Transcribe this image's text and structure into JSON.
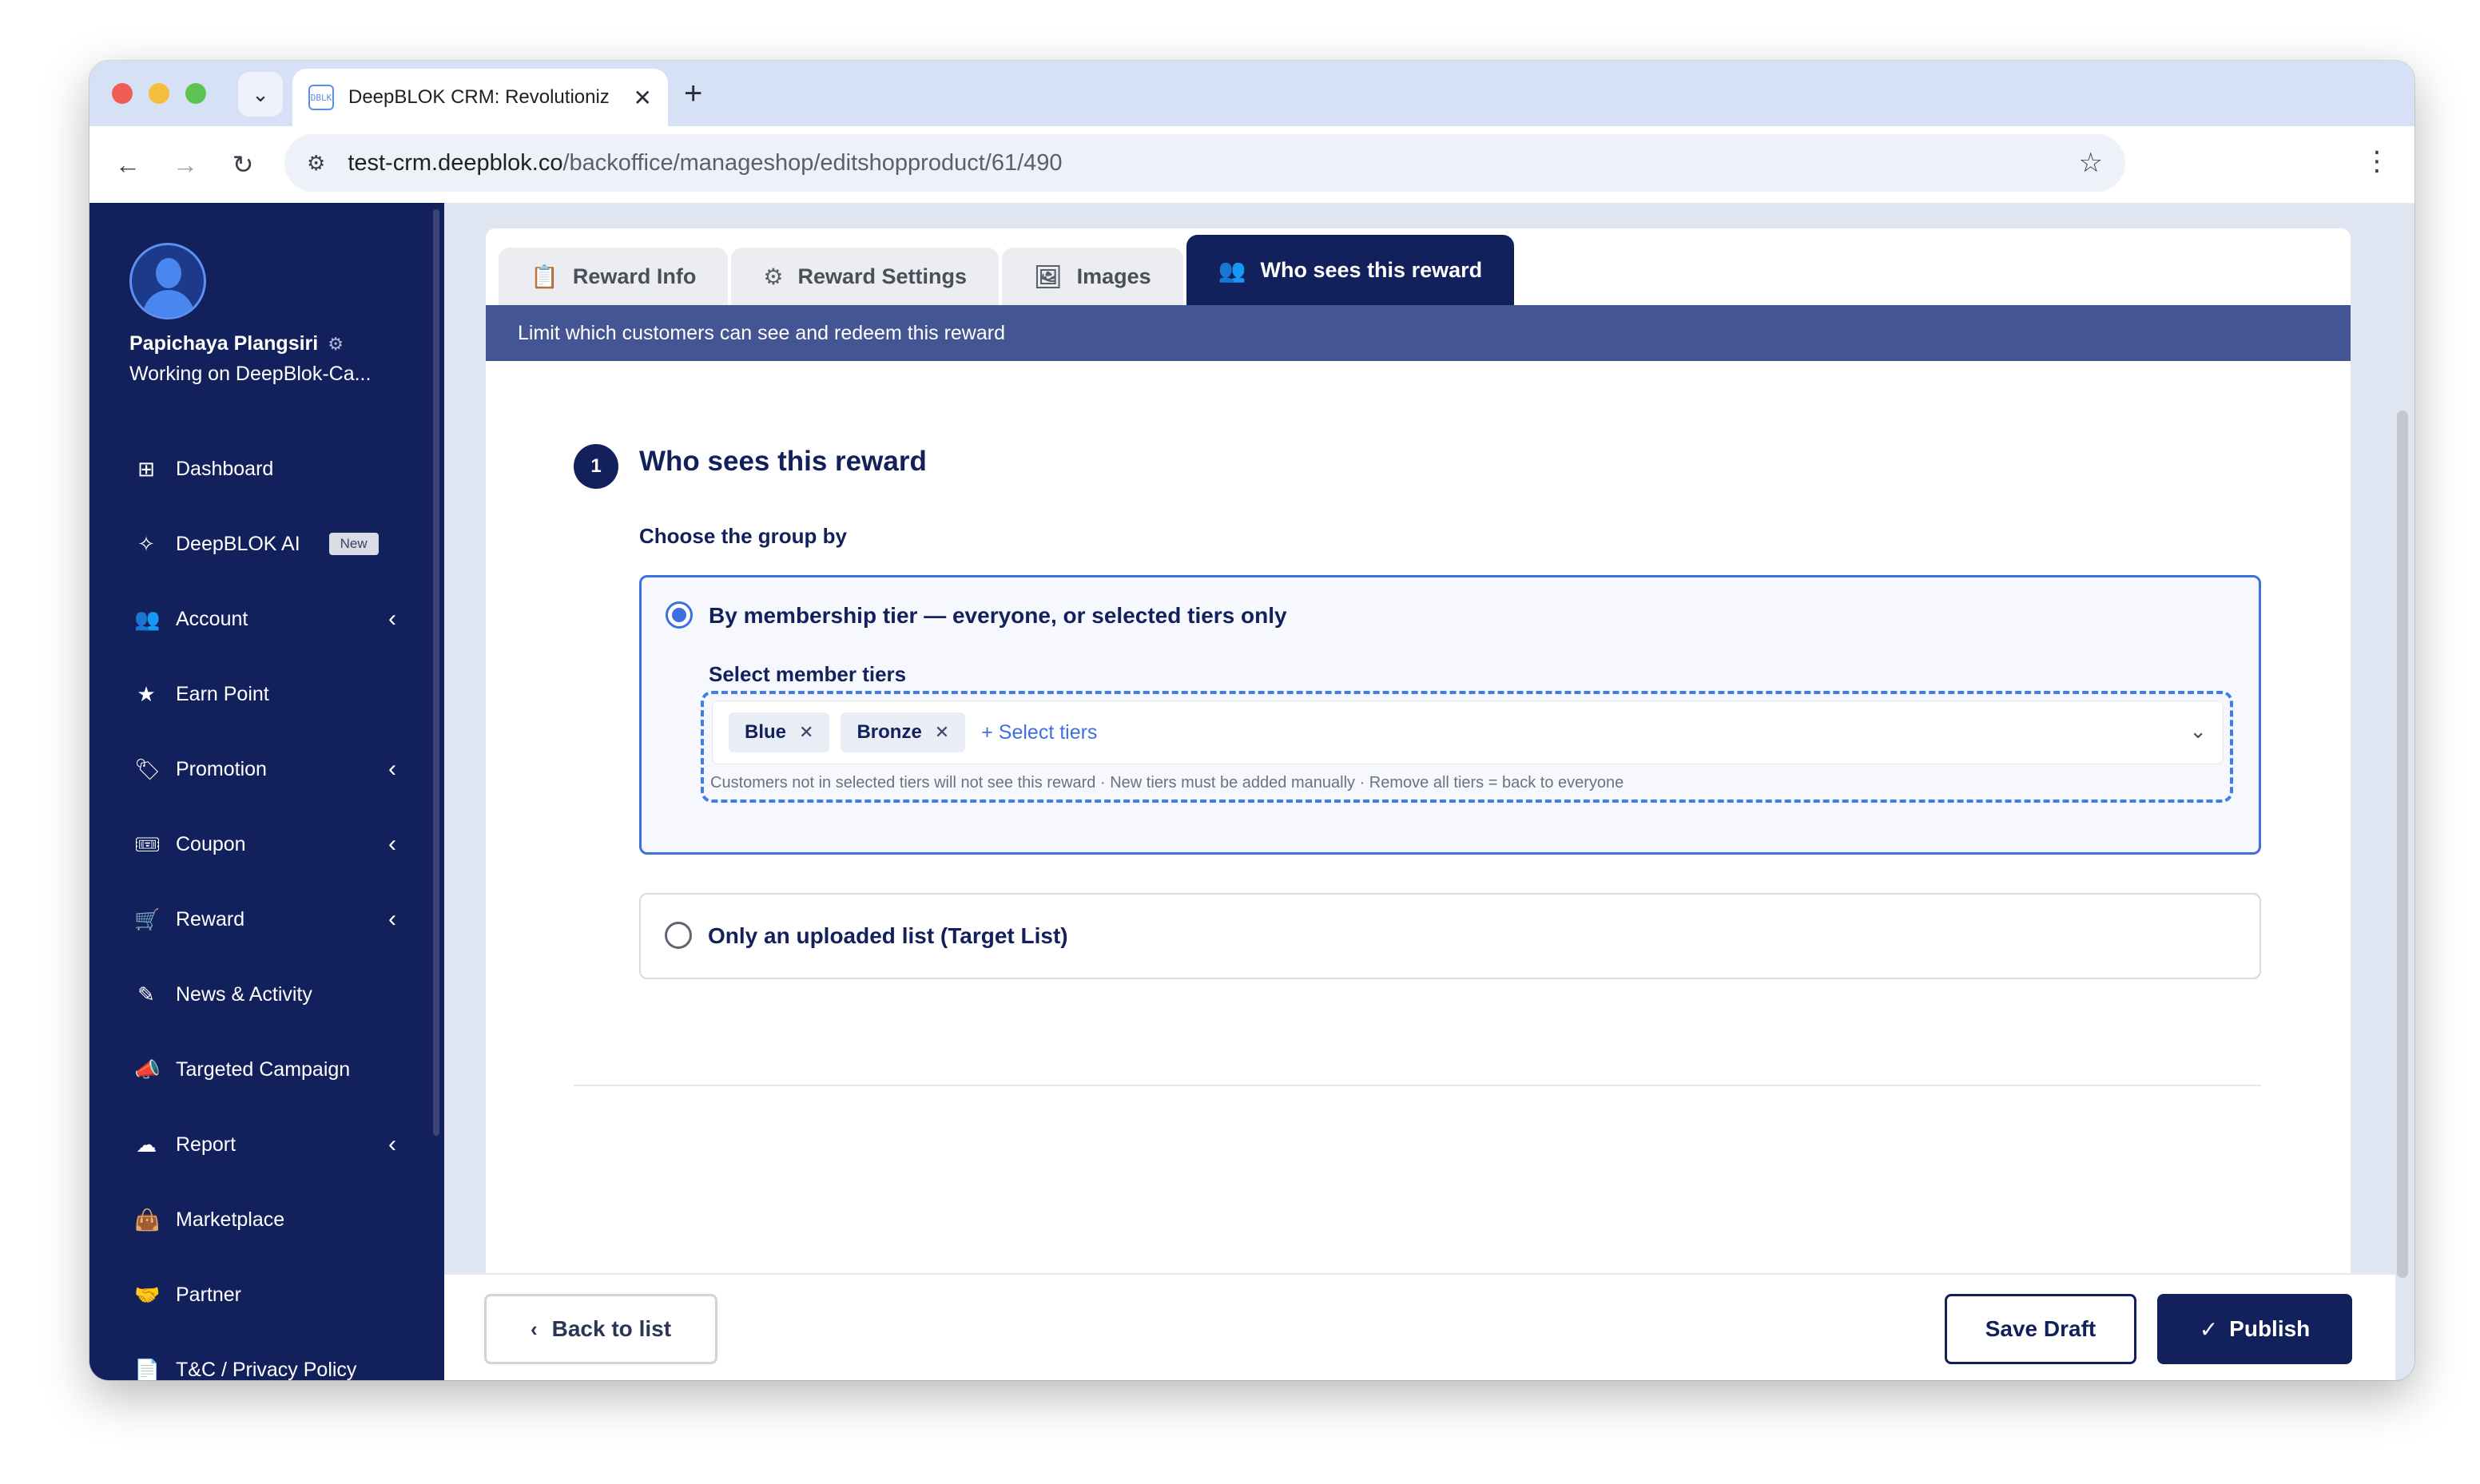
{
  "browser": {
    "tab_title": "DeepBLOK CRM: Revolutioniz",
    "favicon_text": "DBLK",
    "url_host": "test-crm.deepblok.co",
    "url_path": "/backoffice/manageshop/editshopproduct/61/490"
  },
  "user": {
    "name": "Papichaya Plangsiri",
    "workspace": "Working on DeepBlok-Ca..."
  },
  "sidebar": {
    "items": [
      {
        "label": "Dashboard",
        "icon": "grid-icon",
        "glyph": "⊞",
        "chevron": false
      },
      {
        "label": "DeepBLOK AI",
        "icon": "sparkle-icon",
        "glyph": "✧",
        "badge": "New",
        "chevron": false
      },
      {
        "label": "Account",
        "icon": "users-icon",
        "glyph": "👥",
        "chevron": true
      },
      {
        "label": "Earn Point",
        "icon": "star-icon",
        "glyph": "★",
        "chevron": false
      },
      {
        "label": "Promotion",
        "icon": "tag-icon",
        "glyph": "🏷",
        "chevron": true
      },
      {
        "label": "Coupon",
        "icon": "ticket-icon",
        "glyph": "🎟",
        "chevron": true
      },
      {
        "label": "Reward",
        "icon": "cart-icon",
        "glyph": "🛒",
        "chevron": true
      },
      {
        "label": "News & Activity",
        "icon": "edit-icon",
        "glyph": "✎",
        "chevron": false
      },
      {
        "label": "Targeted Campaign",
        "icon": "megaphone-icon",
        "glyph": "📣",
        "chevron": false
      },
      {
        "label": "Report",
        "icon": "cloud-download-icon",
        "glyph": "☁",
        "chevron": true
      },
      {
        "label": "Marketplace",
        "icon": "bag-icon",
        "glyph": "👜",
        "chevron": false
      },
      {
        "label": "Partner",
        "icon": "handshake-icon",
        "glyph": "🤝",
        "chevron": false
      },
      {
        "label": "T&C / Privacy Policy",
        "icon": "document-icon",
        "glyph": "📄",
        "chevron": false
      }
    ]
  },
  "tabs": [
    {
      "label": "Reward Info",
      "icon": "clipboard-icon",
      "glyph": "📋",
      "active": false
    },
    {
      "label": "Reward Settings",
      "icon": "gear-icon",
      "glyph": "⚙",
      "active": false
    },
    {
      "label": "Images",
      "icon": "image-icon",
      "glyph": "🖼",
      "active": false
    },
    {
      "label": "Who sees this reward",
      "icon": "users-icon",
      "glyph": "👥",
      "active": true
    }
  ],
  "tab_info": "Limit which customers can see and redeem this reward",
  "section": {
    "step": "1",
    "title": "Who sees this reward",
    "group_label": "Choose the group by"
  },
  "option_tier": {
    "label": "By membership tier — everyone, or selected tiers only",
    "selected": true,
    "tiers_label": "Select member tiers",
    "chips": [
      "Blue",
      "Bronze"
    ],
    "select_more": "+ Select tiers",
    "hint": "Customers not in selected tiers will not see this reward · New tiers must be added manually · Remove all tiers = back to everyone"
  },
  "option_list": {
    "label": "Only an uploaded list (Target List)",
    "selected": false
  },
  "footer": {
    "back_label": "Back to list",
    "draft_label": "Save Draft",
    "publish_label": "Publish"
  },
  "colors": {
    "navy": "#12205c",
    "accent_blue": "#3f6fe0",
    "info_bar": "#435592"
  }
}
